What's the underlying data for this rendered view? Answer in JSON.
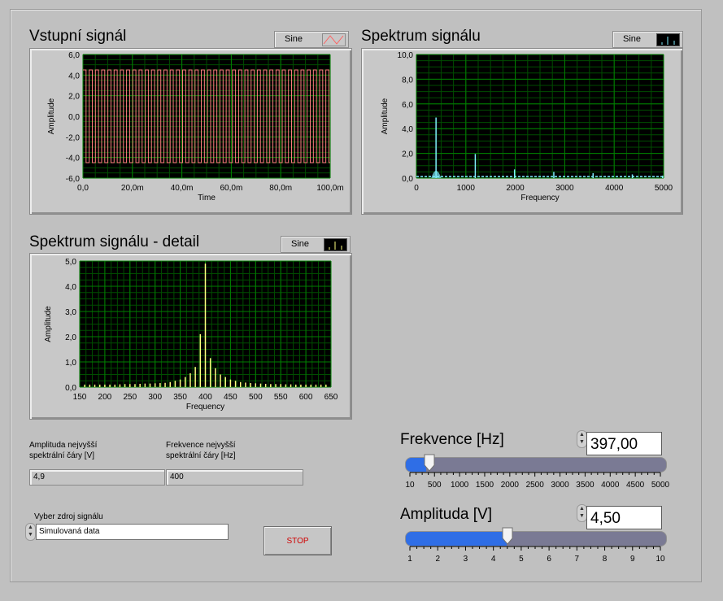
{
  "graphs": [
    {
      "id": "vstup",
      "title": "Vstupní signál",
      "legend": "Sine",
      "plot_color": "#ff8080",
      "chart_data": {
        "type": "line",
        "title": "Vstupní signál",
        "xlabel": "Time",
        "ylabel": "Amplitude",
        "xlim": [
          0,
          0.1
        ],
        "ylim": [
          -6,
          6
        ],
        "xticks": [
          "0,0",
          "20,0m",
          "40,0m",
          "60,0m",
          "80,0m",
          "100,0m"
        ],
        "yticks": [
          "6,0",
          "4,0",
          "2,0",
          "0,0",
          "-2,0",
          "-4,0",
          "-6,0"
        ],
        "series": [
          {
            "name": "Sine",
            "frequency_hz": 397,
            "amplitude": 4.5,
            "waveform": "square"
          }
        ]
      }
    },
    {
      "id": "spektrum",
      "title": "Spektrum signálu",
      "legend": "Sine",
      "plot_color": "#80f0ff",
      "chart_data": {
        "type": "line",
        "title": "Spektrum signálu",
        "xlabel": "Frequency",
        "ylabel": "Amplitude",
        "xlim": [
          0,
          5000
        ],
        "ylim": [
          0,
          10
        ],
        "xticks": [
          "0",
          "1000",
          "2000",
          "3000",
          "4000",
          "5000"
        ],
        "yticks": [
          "10,0",
          "8,0",
          "6,0",
          "4,0",
          "2,0",
          "0,0"
        ],
        "series": [
          {
            "name": "Sine",
            "x": [
              397,
              1191,
              1985,
              2779,
              3573,
              4367,
              4980
            ],
            "y": [
              4.9,
              1.95,
              0.7,
              0.5,
              0.4,
              0.3,
              0.2
            ]
          }
        ]
      }
    },
    {
      "id": "detail",
      "title": "Spektrum signálu - detail",
      "legend": "Sine",
      "plot_color": "#ffff80",
      "chart_data": {
        "type": "bar",
        "title": "Spektrum signálu - detail",
        "xlabel": "Frequency",
        "ylabel": "Amplitude",
        "xlim": [
          150,
          650
        ],
        "ylim": [
          0,
          5
        ],
        "xticks": [
          "150",
          "200",
          "250",
          "300",
          "350",
          "400",
          "450",
          "500",
          "550",
          "600",
          "650"
        ],
        "yticks": [
          "5,0",
          "4,0",
          "3,0",
          "2,0",
          "1,0",
          "0,0"
        ],
        "series": [
          {
            "name": "Sine",
            "x": [
              160,
              170,
              180,
              190,
              200,
              210,
              220,
              230,
              240,
              250,
              260,
              270,
              280,
              290,
              300,
              310,
              320,
              330,
              340,
              350,
              360,
              370,
              380,
              390,
              400,
              410,
              420,
              430,
              440,
              450,
              460,
              470,
              480,
              490,
              500,
              510,
              520,
              530,
              540,
              550,
              560,
              570,
              580,
              590,
              600,
              610,
              620,
              630,
              640
            ],
            "y": [
              0.1,
              0.1,
              0.1,
              0.1,
              0.1,
              0.1,
              0.1,
              0.11,
              0.12,
              0.12,
              0.12,
              0.13,
              0.14,
              0.14,
              0.15,
              0.16,
              0.17,
              0.2,
              0.25,
              0.3,
              0.4,
              0.55,
              0.8,
              2.1,
              4.9,
              1.15,
              0.75,
              0.5,
              0.4,
              0.3,
              0.25,
              0.2,
              0.18,
              0.16,
              0.15,
              0.14,
              0.13,
              0.12,
              0.12,
              0.12,
              0.11,
              0.11,
              0.1,
              0.1,
              0.1,
              0.1,
              0.1,
              0.1,
              0.1
            ]
          }
        ]
      }
    }
  ],
  "indicators": {
    "amp_label": "Amplituda nejvyšší\nspektrální čáry [V]",
    "amp_value": "4,9",
    "freq_label": "Frekvence nejvyšší\nspektrální čáry [Hz]",
    "freq_value": "400"
  },
  "source": {
    "label": "Vyber zdroj signálu",
    "value": "Simulovaná data"
  },
  "stop_label": "STOP",
  "freq_slider": {
    "title": "Frekvence [Hz]",
    "value": "397,00",
    "level": 397,
    "min": 10,
    "max": 5000,
    "ticks": [
      "10",
      "500",
      "1000",
      "1500",
      "2000",
      "2500",
      "3000",
      "3500",
      "4000",
      "4500",
      "5000"
    ]
  },
  "amp_slider": {
    "title": "Amplituda [V]",
    "value": "4,50",
    "level": 4.5,
    "min": 1,
    "max": 10,
    "ticks": [
      "1",
      "2",
      "3",
      "4",
      "5",
      "6",
      "7",
      "8",
      "9",
      "10"
    ]
  },
  "colors": {
    "plot_bg": "#000000",
    "grid": "#008000",
    "slider_fill": "#2f6ee6",
    "stop_text": "#d00000"
  }
}
